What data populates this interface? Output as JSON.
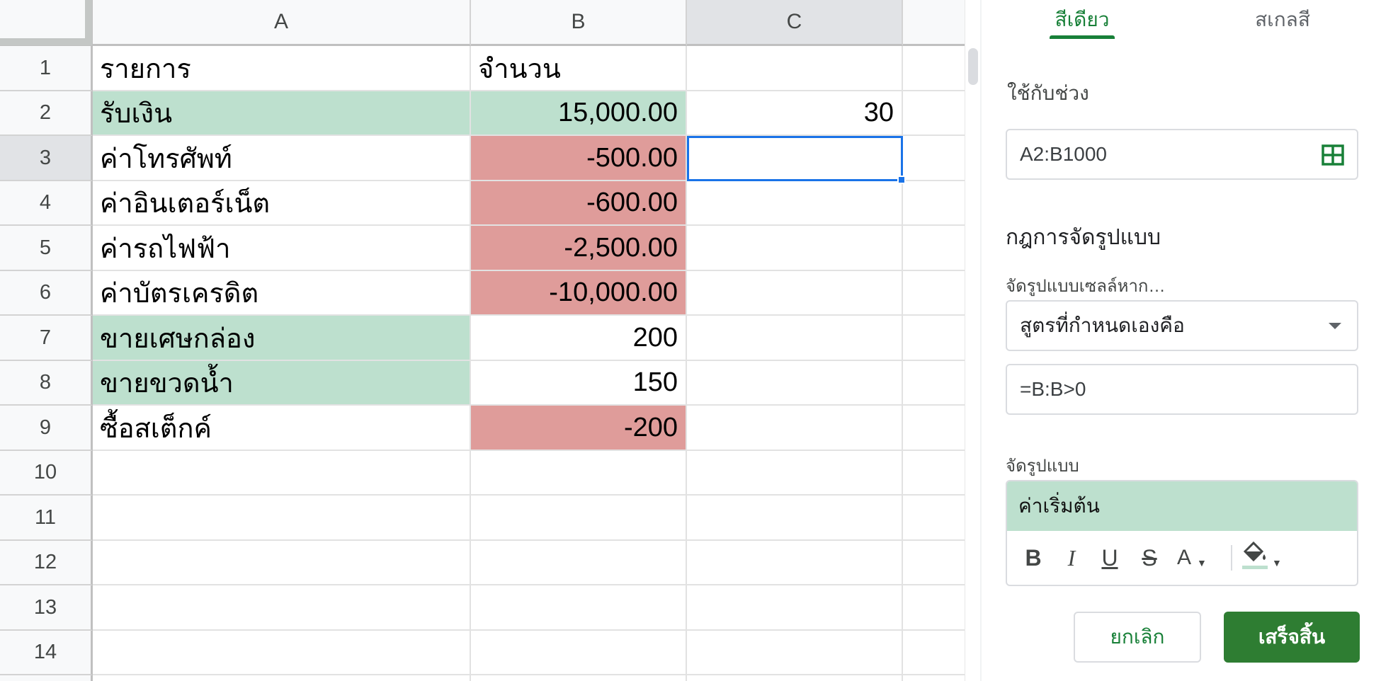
{
  "grid": {
    "columns": [
      "A",
      "B",
      "C"
    ],
    "rows": [
      "1",
      "2",
      "3",
      "4",
      "5",
      "6",
      "7",
      "8",
      "9",
      "10",
      "11",
      "12",
      "13",
      "14"
    ],
    "cells": {
      "a1": "รายการ",
      "b1": "จำนวน",
      "a2": "รับเงิน",
      "b2": "15,000.00",
      "c2": "30",
      "a3": "ค่าโทรศัพท์",
      "b3": "-500.00",
      "a4": "ค่าอินเตอร์เน็ต",
      "b4": "-600.00",
      "a5": "ค่ารถไฟฟ้า",
      "b5": "-2,500.00",
      "a6": "ค่าบัตรเครดิต",
      "b6": "-10,000.00",
      "a7": "ขายเศษกล่อง",
      "b7": "200",
      "a8": "ขายขวดน้ำ",
      "b8": "150",
      "a9": "ซื้อสเต็กค์",
      "b9": "-200"
    },
    "selected_cell": "C3",
    "colors": {
      "green_fill": "#bde0ce",
      "red_fill": "#df9c9a",
      "selection": "#1a73e8"
    }
  },
  "panel": {
    "tabs": [
      "สีเดียว",
      "สเกลสี"
    ],
    "active_tab": "สีเดียว",
    "apply_range_label": "ใช้กับช่วง",
    "range_value": "A2:B1000",
    "rules_heading": "กฎการจัดรูปแบบ",
    "condition_label": "จัดรูปแบบเซลล์หาก…",
    "condition_value": "สูตรที่กำหนดเองคือ",
    "formula_value": "=B:B>0",
    "style_label": "จัดรูปแบบ",
    "style_preview": "ค่าเริ่มต้น",
    "toolbar": {
      "bold": "B",
      "italic": "I",
      "underline": "U",
      "strike": "S",
      "text_color": "A"
    },
    "cancel_label": "ยกเลิก",
    "done_label": "เสร็จสิ้น",
    "accent_color": "#188038"
  }
}
